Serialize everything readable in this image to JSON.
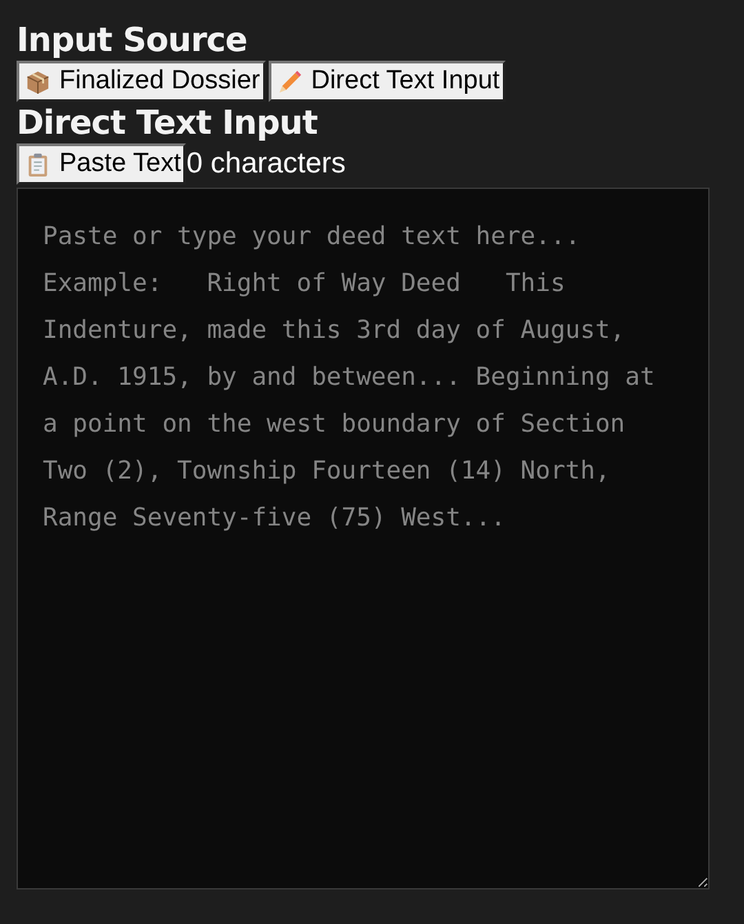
{
  "input_source": {
    "title": "Input Source",
    "buttons": [
      {
        "label": "Finalized Dossier",
        "kind": "box"
      },
      {
        "label": "Direct Text Input",
        "kind": "pencil"
      }
    ]
  },
  "direct_text_input": {
    "title": "Direct Text Input",
    "paste_button": {
      "label": "Paste Text",
      "kind": "clipboard"
    },
    "character_count": "0 characters",
    "textarea": {
      "placeholder": "Paste or type your deed text here... Example:   Right of Way Deed   This Indenture, made this 3rd day of August, A.D. 1915, by and between... Beginning at a point on the west boundary of Section Two (2), Township Fourteen (14) North, Range Seventy-five (75) West..."
    }
  }
}
